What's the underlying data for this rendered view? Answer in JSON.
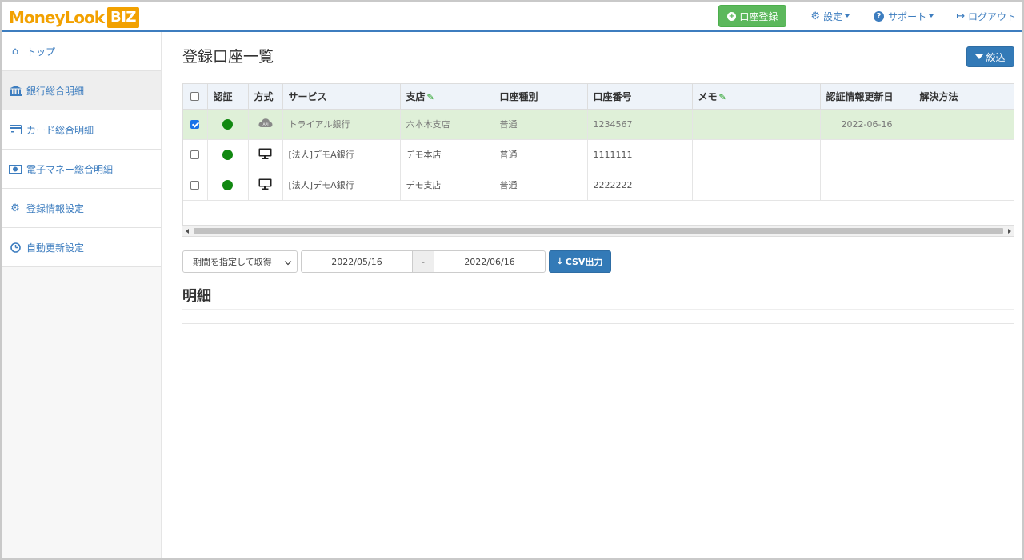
{
  "header": {
    "logo_text": "MoneyLook",
    "logo_badge": "BIZ",
    "register_label": "口座登録",
    "settings_label": "設定",
    "support_label": "サポート",
    "logout_label": "ログアウト"
  },
  "sidebar": {
    "items": [
      {
        "label": "トップ",
        "icon": "home-icon"
      },
      {
        "label": "銀行総合明細",
        "icon": "bank-icon"
      },
      {
        "label": "カード総合明細",
        "icon": "credit-card-icon"
      },
      {
        "label": "電子マネー総合明細",
        "icon": "money-icon"
      },
      {
        "label": "登録情報設定",
        "icon": "gear-icon"
      },
      {
        "label": "自動更新設定",
        "icon": "clock-icon"
      }
    ]
  },
  "main": {
    "title": "登録口座一覧",
    "filter_label": "絞込",
    "table": {
      "headers": [
        "認証",
        "方式",
        "サービス",
        "支店",
        "口座種別",
        "口座番号",
        "メモ",
        "認証情報更新日",
        "解決方法"
      ],
      "rows": [
        {
          "checked": true,
          "method": "API",
          "service": "トライアル銀行",
          "branch": "六本木支店",
          "type": "普通",
          "number": "1234567",
          "memo": "",
          "updated": "2022-06-16",
          "resolution": ""
        },
        {
          "checked": false,
          "method": "monitor",
          "service": "[法人]デモA銀行",
          "branch": "デモ本店",
          "type": "普通",
          "number": "1111111",
          "memo": "",
          "updated": "",
          "resolution": ""
        },
        {
          "checked": false,
          "method": "monitor",
          "service": "[法人]デモA銀行",
          "branch": "デモ支店",
          "type": "普通",
          "number": "2222222",
          "memo": "",
          "updated": "",
          "resolution": ""
        }
      ]
    },
    "period_select": "期間を指定して取得",
    "date_from": "2022/05/16",
    "date_sep": "-",
    "date_to": "2022/06/16",
    "csv_label": "CSV出力",
    "detail_title": "明細"
  },
  "colors": {
    "brand_orange": "#f2a100",
    "link_blue": "#3d7dbf",
    "primary_button": "#337ab7",
    "success_button": "#5cb85c",
    "selected_row": "#dff0d8",
    "status_dot": "#118811"
  }
}
